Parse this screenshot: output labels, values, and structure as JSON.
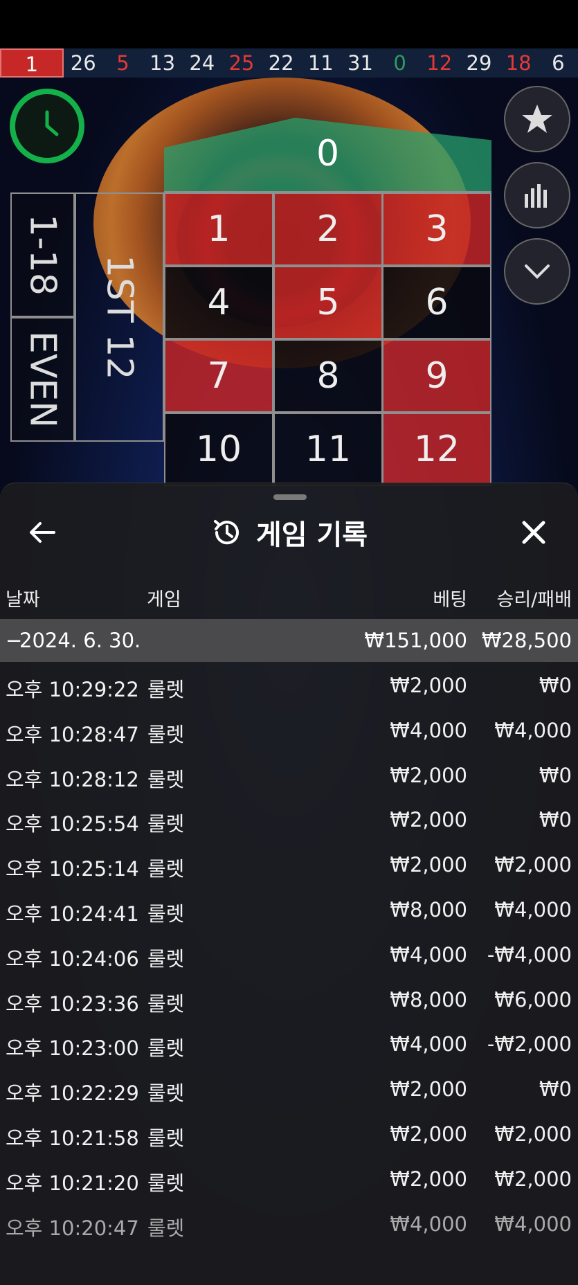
{
  "results_strip": {
    "numbers": [
      {
        "value": "1",
        "color": "red"
      },
      {
        "value": "26",
        "color": "black"
      },
      {
        "value": "5",
        "color": "red"
      },
      {
        "value": "13",
        "color": "black"
      },
      {
        "value": "24",
        "color": "black"
      },
      {
        "value": "25",
        "color": "red"
      },
      {
        "value": "22",
        "color": "black"
      },
      {
        "value": "11",
        "color": "black"
      },
      {
        "value": "31",
        "color": "black"
      },
      {
        "value": "0",
        "color": "green"
      },
      {
        "value": "12",
        "color": "red"
      },
      {
        "value": "29",
        "color": "black"
      },
      {
        "value": "18",
        "color": "red"
      },
      {
        "value": "6",
        "color": "black"
      }
    ]
  },
  "board": {
    "zero": "0",
    "numbers": [
      {
        "n": "1",
        "c": "red"
      },
      {
        "n": "2",
        "c": "red"
      },
      {
        "n": "3",
        "c": "red"
      },
      {
        "n": "4",
        "c": "black"
      },
      {
        "n": "5",
        "c": "red"
      },
      {
        "n": "6",
        "c": "black"
      },
      {
        "n": "7",
        "c": "red"
      },
      {
        "n": "8",
        "c": "black"
      },
      {
        "n": "9",
        "c": "red"
      },
      {
        "n": "10",
        "c": "black"
      },
      {
        "n": "11",
        "c": "black"
      },
      {
        "n": "12",
        "c": "red"
      }
    ],
    "low_label": "1-18",
    "even_label": "EVEN",
    "dozen_label": "1ST 12"
  },
  "sheet": {
    "title": "게임 기록",
    "columns": {
      "date": "날짜",
      "game": "게임",
      "bet": "베팅",
      "result": "승리/패배"
    },
    "day": {
      "date": "2024. 6. 30.",
      "bet": "₩151,000",
      "result": "₩28,500"
    },
    "rows": [
      {
        "time": "오후 10:29:22",
        "game": "룰렛",
        "bet": "₩2,000",
        "result": "₩0"
      },
      {
        "time": "오후 10:28:47",
        "game": "룰렛",
        "bet": "₩4,000",
        "result": "₩4,000"
      },
      {
        "time": "오후 10:28:12",
        "game": "룰렛",
        "bet": "₩2,000",
        "result": "₩0"
      },
      {
        "time": "오후 10:25:54",
        "game": "룰렛",
        "bet": "₩2,000",
        "result": "₩0"
      },
      {
        "time": "오후 10:25:14",
        "game": "룰렛",
        "bet": "₩2,000",
        "result": "₩2,000"
      },
      {
        "time": "오후 10:24:41",
        "game": "룰렛",
        "bet": "₩8,000",
        "result": "₩4,000"
      },
      {
        "time": "오후 10:24:06",
        "game": "룰렛",
        "bet": "₩4,000",
        "result": "-₩4,000"
      },
      {
        "time": "오후 10:23:36",
        "game": "룰렛",
        "bet": "₩8,000",
        "result": "₩6,000"
      },
      {
        "time": "오후 10:23:00",
        "game": "룰렛",
        "bet": "₩4,000",
        "result": "-₩2,000"
      },
      {
        "time": "오후 10:22:29",
        "game": "룰렛",
        "bet": "₩2,000",
        "result": "₩0"
      },
      {
        "time": "오후 10:21:58",
        "game": "룰렛",
        "bet": "₩2,000",
        "result": "₩2,000"
      },
      {
        "time": "오후 10:21:20",
        "game": "룰렛",
        "bet": "₩2,000",
        "result": "₩2,000"
      },
      {
        "time": "오후 10:20:47",
        "game": "룰렛",
        "bet": "₩4,000",
        "result": "₩4,000"
      }
    ]
  },
  "colors": {
    "red": "#e53935",
    "black": "#e8e8e8",
    "green": "#2e9e5b",
    "accent_green": "#14b04a"
  },
  "icons": {
    "back": "arrow-left-icon",
    "history": "history-icon",
    "close": "close-icon",
    "timer": "clock-icon",
    "favorite": "star-icon",
    "stats": "bar-chart-icon",
    "collapse": "chevron-down-icon"
  }
}
